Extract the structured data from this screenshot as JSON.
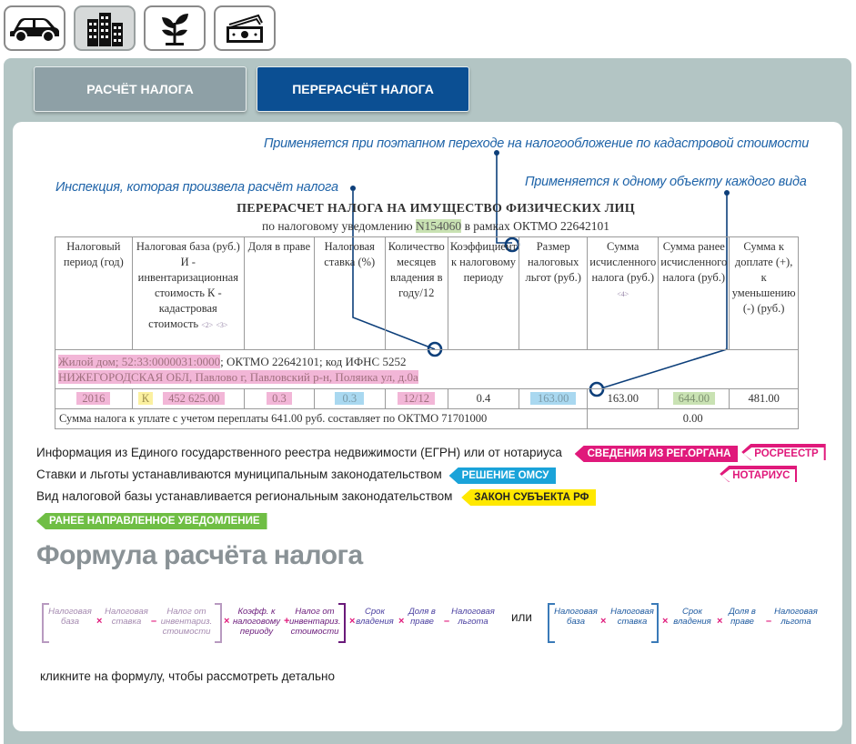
{
  "categories": [
    {
      "name": "car-icon"
    },
    {
      "name": "buildings-icon"
    },
    {
      "name": "plant-icon"
    },
    {
      "name": "money-icon"
    }
  ],
  "tabs": [
    {
      "label": "РАСЧЁТ НАЛОГА"
    },
    {
      "label": "ПЕРЕРАСЧЁТ НАЛОГА"
    }
  ],
  "notes": {
    "cadastral": "Применяется при поэтапном переходе на налогообложение по кадастровой стоимости",
    "inspection": "Инспекция, которая произвела расчёт налога",
    "one_object": "Применяется к одному объекту каждого вида"
  },
  "document": {
    "title": "ПЕРЕРАСЧЕТ НАЛОГА НА ИМУЩЕСТВО ФИЗИЧЕСКИХ ЛИЦ",
    "subtitle_prefix": "по налоговому уведомлению",
    "notice_number": "N154060",
    "subtitle_suffix": "в рамках ОКТМО 22642101",
    "headers": [
      "Налоговый период (год)",
      "Налоговая база (руб.) И - инвентаризационная стоимость К - кадастровая стоимость",
      "Доля в праве",
      "Налоговая ставка (%)",
      "Количество месяцев владения в году/12",
      "Коэффициент к налоговому периоду",
      "Размер налоговых льгот (руб.)",
      "Сумма исчисленного налога (руб.)",
      "Сумма ранее исчисленного налога (руб.)",
      "Сумма к доплате (+), к уменьшению (-) (руб.)"
    ],
    "header_marks": {
      "base_mark1": "<2>",
      "base_mark2": "<3>",
      "sum_mark": "<4>"
    },
    "object_line1_highlight": "Жилой дом; 52:33:0000031:0000",
    "object_line1_rest": "; ОКТМО 22642101; код ИФНС 5252",
    "object_line2": "НИЖЕГОРОДСКАЯ ОБЛ, Павлово г, Павловский р-н, Поляика ул, д.0а",
    "row": {
      "period": "2016",
      "base_type": "К",
      "base": "452 625.00",
      "share": "0.3",
      "rate": "0.3",
      "months": "12/12",
      "coef": "0.4",
      "benefits": "163.00",
      "calculated": "163.00",
      "previous": "644.00",
      "diff": "481.00"
    },
    "summary": "Сумма налога к уплате с учетом переплаты 641.00 руб. составляет по ОКТМО 71701000",
    "summary_value": "0.00"
  },
  "legend": {
    "egrn_text": "Информация из Единого государственного реестра недвижимости (ЕГРН) или от нотариуса",
    "egrn_tag": "СВЕДЕНИЯ ИЗ РЕГ.ОРГАНА",
    "rosreestr_tag": "РОСРЕЕСТР",
    "notary_tag": "НОТАРИУС",
    "rates_text": "Ставки и льготы устанавливаются муниципальным законодательством",
    "rates_tag": "РЕШЕНИЕ ОМСУ",
    "base_type_text": "Вид налоговой базы устанавливается региональным законодательством",
    "base_type_tag": "ЗАКОН СУБЪЕКТА РФ",
    "notice_tag": "РАНЕЕ НАПРАВЛЕННОЕ УВЕДОМЛЕНИЕ"
  },
  "formula": {
    "heading": "Формула расчёта налога",
    "left": [
      "Налоговая база",
      "Налоговая ставка",
      "Налог от инвентариз. стоимости",
      "Коэфф. к налоговому периоду",
      "Налог от инвентариз. стоимости",
      "Срок владения",
      "Доля в праве",
      "Налоговая льгота"
    ],
    "or": "или",
    "right": [
      "Налоговая база",
      "Налоговая ставка",
      "Срок владения",
      "Доля в праве",
      "Налоговая льгота"
    ],
    "hint": "кликните на  формулу, чтобы рассмотреть детально"
  },
  "colors": {
    "accent": "#0b4f93",
    "note": "#1e63a8",
    "pink": "#e0197b",
    "blue": "#1aa3d9",
    "yellow": "#ffe800",
    "green": "#6fbe44"
  }
}
